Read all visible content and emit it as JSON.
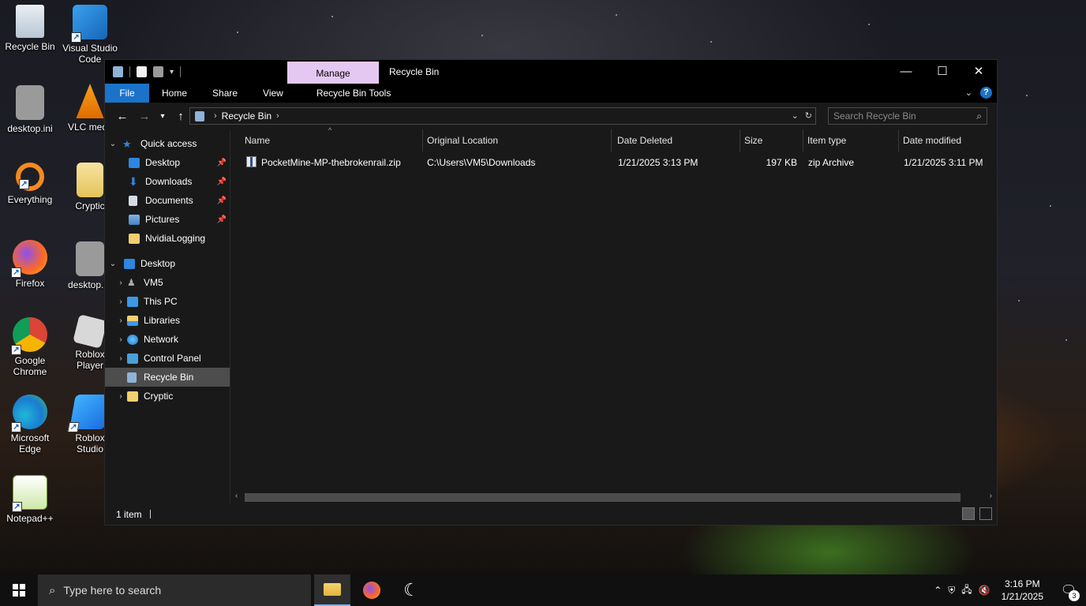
{
  "desktop": {
    "icons": [
      {
        "label": "Recycle Bin",
        "icon": "recycle-bin-icon"
      },
      {
        "label": "Visual Studio Code",
        "icon": "vscode-icon"
      },
      {
        "label": "desktop.ini",
        "icon": "settings-file-icon"
      },
      {
        "label": "VLC media player",
        "icon": "vlc-icon"
      },
      {
        "label": "Everything",
        "icon": "everything-search-icon"
      },
      {
        "label": "Cryptic",
        "icon": "folder-icon"
      },
      {
        "label": "Firefox",
        "icon": "firefox-icon"
      },
      {
        "label": "desktop.ini",
        "icon": "settings-file-icon"
      },
      {
        "label": "Google Chrome",
        "icon": "chrome-icon"
      },
      {
        "label": "Roblox Player",
        "icon": "roblox-icon"
      },
      {
        "label": "Microsoft Edge",
        "icon": "edge-icon"
      },
      {
        "label": "Roblox Studio",
        "icon": "roblox-studio-icon"
      },
      {
        "label": "Notepad++",
        "icon": "notepadpp-icon"
      }
    ]
  },
  "explorer": {
    "title": "Recycle Bin",
    "contextual_tab": "Manage",
    "ribbon_tabs": [
      "File",
      "Home",
      "Share",
      "View",
      "Recycle Bin Tools"
    ],
    "address": {
      "path": "Recycle Bin"
    },
    "search": {
      "placeholder": "Search Recycle Bin"
    },
    "nav_pane": {
      "quick_access": "Quick access",
      "quick_items": [
        {
          "label": "Desktop",
          "pinned": true
        },
        {
          "label": "Downloads",
          "pinned": true
        },
        {
          "label": "Documents",
          "pinned": true
        },
        {
          "label": "Pictures",
          "pinned": true
        },
        {
          "label": "NvidiaLogging",
          "pinned": false
        }
      ],
      "desktop": "Desktop",
      "desktop_items": [
        "VM5",
        "This PC",
        "Libraries",
        "Network",
        "Control Panel",
        "Recycle Bin",
        "Cryptic"
      ],
      "selected": "Recycle Bin"
    },
    "columns": [
      "Name",
      "Original Location",
      "Date Deleted",
      "Size",
      "Item type",
      "Date modified"
    ],
    "files": [
      {
        "name": "PocketMine-MP-thebrokenrail.zip",
        "original_location": "C:\\Users\\VM5\\Downloads",
        "date_deleted": "1/21/2025 3:13 PM",
        "size": "197 KB",
        "item_type": "zip Archive",
        "date_modified": "1/21/2025 3:11 PM"
      }
    ],
    "status": {
      "item_count": "1 item"
    }
  },
  "taskbar": {
    "search_placeholder": "Type here to search",
    "apps": [
      "file-explorer-icon",
      "firefox-icon",
      "moon-app-icon"
    ],
    "clock": {
      "time": "3:16 PM",
      "date": "1/21/2025"
    },
    "notifications_badge": "3"
  }
}
